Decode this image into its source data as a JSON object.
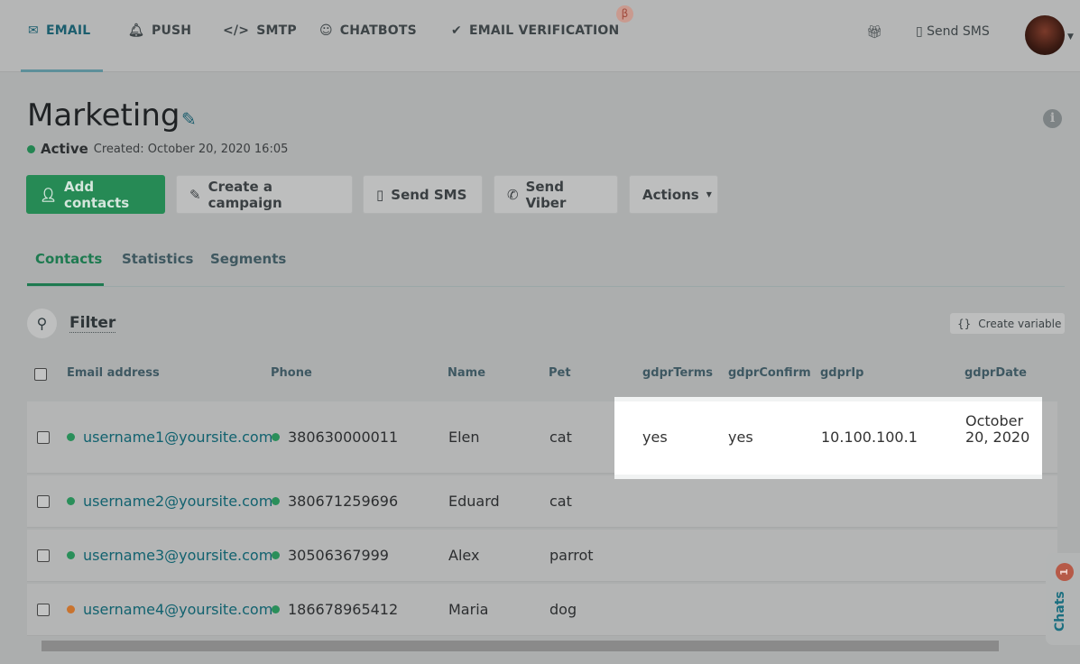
{
  "nav": {
    "items": [
      {
        "label": "EMAIL",
        "icon": "envelope-icon",
        "active": true
      },
      {
        "label": "PUSH",
        "icon": "bell-icon"
      },
      {
        "label": "SMTP",
        "icon": "code-icon"
      },
      {
        "label": "CHATBOTS",
        "icon": "chatbot-icon"
      },
      {
        "label": "EMAIL VERIFICATION",
        "icon": "check-circle-icon"
      }
    ],
    "beta": "β",
    "send_sms": "Send SMS"
  },
  "header": {
    "title": "Marketing",
    "status": "Active",
    "created": "Created: October 20, 2020 16:05"
  },
  "actions": {
    "add": "Add contacts",
    "campaign": "Create a campaign",
    "sms": "Send SMS",
    "viber": "Send Viber",
    "more": "Actions"
  },
  "tabs": [
    "Contacts",
    "Statistics",
    "Segments"
  ],
  "filter": {
    "label": "Filter",
    "create_variable": "Create variable"
  },
  "table": {
    "columns": [
      "Email address",
      "Phone",
      "Name",
      "Pet",
      "gdprTerms",
      "gdprConfirm",
      "gdprIp",
      "gdprDate"
    ],
    "rows": [
      {
        "email": "username1@yoursite.com",
        "email_status": "#2a8f5a",
        "phone": "380630000011",
        "name": "Elen",
        "pet": "cat",
        "gdprTerms": "yes",
        "gdprConfirm": "yes",
        "gdprIp": "10.100.100.1",
        "gdprDate": "October 20, 2020"
      },
      {
        "email": "username2@yoursite.com",
        "email_status": "#2a8f5a",
        "phone": "380671259696",
        "name": "Eduard",
        "pet": "cat"
      },
      {
        "email": "username3@yoursite.com",
        "email_status": "#2a8f5a",
        "phone": "30506367999",
        "name": "Alex",
        "pet": "parrot"
      },
      {
        "email": "username4@yoursite.com",
        "email_status": "#c9732e",
        "phone": "186678965412",
        "name": "Maria",
        "pet": "dog"
      }
    ]
  },
  "chats": {
    "label": "Chats",
    "badge": "1"
  },
  "colors": {
    "accent": "#1c5e6e",
    "green": "#268a55",
    "active_tab": "#1e7a50"
  }
}
